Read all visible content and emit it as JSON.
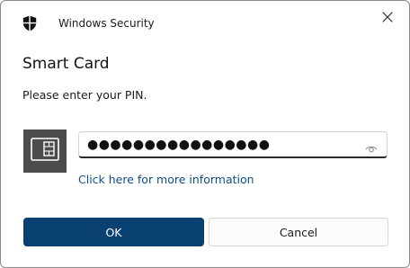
{
  "window": {
    "app_title": "Windows Security",
    "app_icon": "shield-icon",
    "close_icon": "close-icon"
  },
  "dialog": {
    "heading": "Smart Card",
    "prompt": "Please enter your PIN.",
    "card_icon": "smart-card-icon"
  },
  "pin_input": {
    "value": "●●●●●●●●●●●●●●●●",
    "masked": true,
    "reveal_icon": "eye-icon"
  },
  "link": {
    "label": "Click here for more information"
  },
  "buttons": {
    "ok_label": "OK",
    "cancel_label": "Cancel"
  },
  "colors": {
    "primary_button": "#0a4173",
    "link": "#0e4d88",
    "card_tile": "#4c4c4c"
  }
}
